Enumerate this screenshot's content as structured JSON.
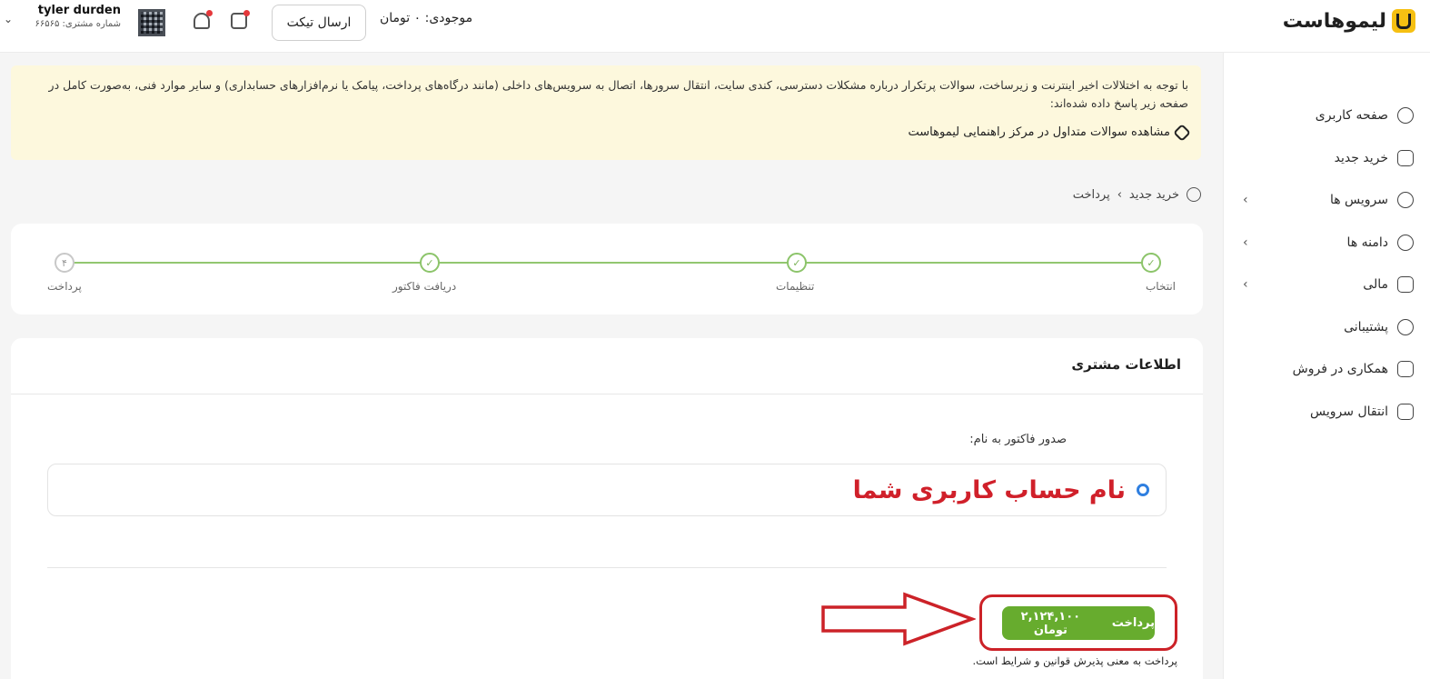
{
  "header": {
    "logo_text": "لیموهاست",
    "balance": "موجودی: ۰ تومان",
    "ticket_button": "ارسال تیکت",
    "user_name": "tyler durden",
    "user_id": "شماره مشتری: ۶۶۵۶۵"
  },
  "sidebar": {
    "items": [
      {
        "label": "صفحه کاربری",
        "icon": "user-icon",
        "has_sub": false
      },
      {
        "label": "خرید جدید",
        "icon": "bag-icon",
        "has_sub": false
      },
      {
        "label": "سرویس ها",
        "icon": "gear-icon",
        "has_sub": true
      },
      {
        "label": "دامنه ها",
        "icon": "globe-icon",
        "has_sub": true
      },
      {
        "label": "مالی",
        "icon": "money-icon",
        "has_sub": true
      },
      {
        "label": "پشتیبانی",
        "icon": "headset-icon",
        "has_sub": false
      },
      {
        "label": "همکاری در فروش",
        "icon": "chat-icon",
        "has_sub": false
      },
      {
        "label": "انتقال سرویس",
        "icon": "transfer-icon",
        "has_sub": false
      }
    ]
  },
  "alert": {
    "text": "با توجه به اختلالات اخیر اینترنت و زیرساخت، سوالات پرتکرار درباره مشکلات دسترسی، کندی سایت، انتقال سرورها، اتصال به سرویس‌های داخلی (مانند درگاه‌های پرداخت، پیامک یا نرم‌افزارهای حسابداری) و سایر موارد فنی، به‌صورت کامل در صفحه زیر پاسخ داده شده‌اند:",
    "link": "مشاهده سوالات متداول در مرکز راهنمایی لیموهاست"
  },
  "breadcrumb": {
    "first": "خرید جدید",
    "separator": "›",
    "current": "پرداخت"
  },
  "stepper": {
    "steps": [
      {
        "label": "انتخاب",
        "done": true,
        "number": ""
      },
      {
        "label": "تنظیمات",
        "done": true,
        "number": ""
      },
      {
        "label": "دریافت فاکتور",
        "done": true,
        "number": ""
      },
      {
        "label": "پرداخت",
        "done": false,
        "number": "۴"
      }
    ]
  },
  "customer": {
    "title": "اطلاعات مشتری",
    "invoice_label": "صدور فاکتور به نام:",
    "account_name": "نام حساب کاربری شما",
    "pay_label": "پرداخت",
    "pay_amount": "۲,۱۲۴,۱۰۰ تومان",
    "terms_note": "پرداخت به معنی پذیرش قوانین و شرایط است."
  },
  "colors": {
    "accent_green": "#67ac2e",
    "highlight_red": "#cc2228",
    "alert_bg": "#fdf8dd",
    "radio_blue": "#2f7fe0"
  }
}
